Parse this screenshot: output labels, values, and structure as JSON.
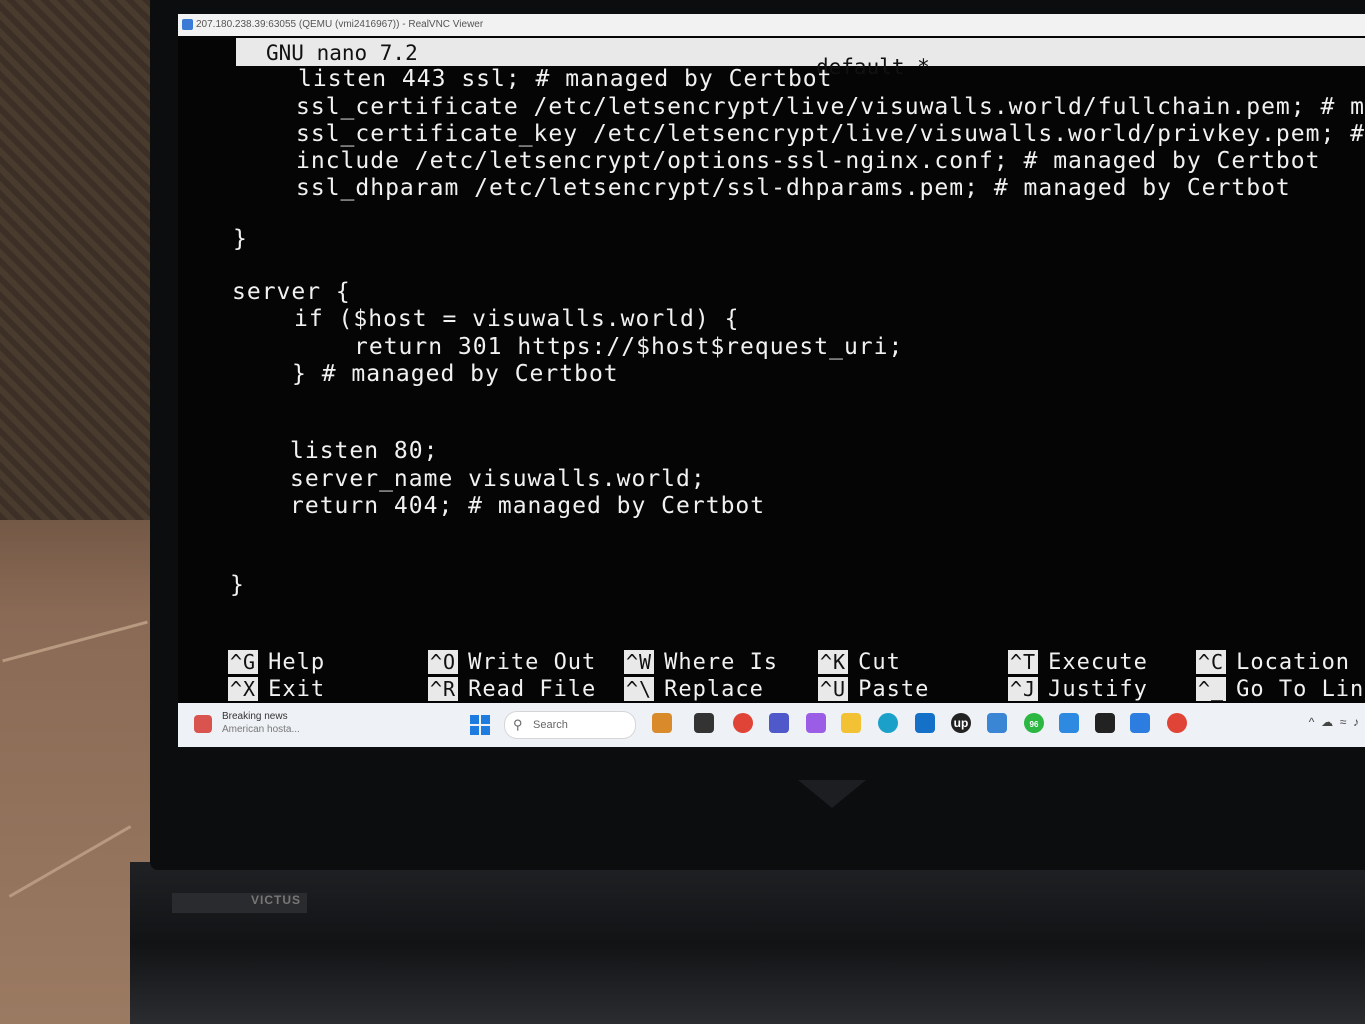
{
  "vnc": {
    "title": "207.180.238.39:63055 (QEMU (vmi2416967)) - RealVNC Viewer"
  },
  "nano": {
    "version": "GNU nano 7.2",
    "filename": "default *"
  },
  "code_lines": [
    "listen 443 ssl; # managed by Certbot",
    "ssl_certificate /etc/letsencrypt/live/visuwalls.world/fullchain.pem; # man",
    "ssl_certificate_key /etc/letsencrypt/live/visuwalls.world/privkey.pem; # m",
    "include /etc/letsencrypt/options-ssl-nginx.conf; # managed by Certbot",
    "ssl_dhparam /etc/letsencrypt/ssl-dhparams.pem; # managed by Certbot",
    "}",
    "server {",
    "if ($host = visuwalls.world) {",
    "return 301 https://$host$request_uri;",
    "} # managed by Certbot",
    "listen 80;",
    "server_name visuwalls.world;",
    "return 404; # managed by Certbot",
    "}"
  ],
  "shortcuts": [
    {
      "key": "^G",
      "label": "Help"
    },
    {
      "key": "^X",
      "label": "Exit"
    },
    {
      "key": "^O",
      "label": "Write Out"
    },
    {
      "key": "^R",
      "label": "Read File"
    },
    {
      "key": "^W",
      "label": "Where Is"
    },
    {
      "key": "^\\",
      "label": "Replace"
    },
    {
      "key": "^K",
      "label": "Cut"
    },
    {
      "key": "^U",
      "label": "Paste"
    },
    {
      "key": "^T",
      "label": "Execute"
    },
    {
      "key": "^J",
      "label": "Justify"
    },
    {
      "key": "^C",
      "label": "Location"
    },
    {
      "key": "^_",
      "label": "Go To Lin"
    }
  ],
  "taskbar": {
    "news_title": "Breaking news",
    "news_subtitle": "American hosta...",
    "search_placeholder": "Search",
    "whatsapp_badge": "96",
    "upwork_label": "up"
  },
  "laptop": {
    "hinge_label": "VICTUS"
  },
  "colors": {
    "screen_bg": "#050505",
    "text": "#f1f1f1",
    "title_bar": "#e9e9e9"
  }
}
